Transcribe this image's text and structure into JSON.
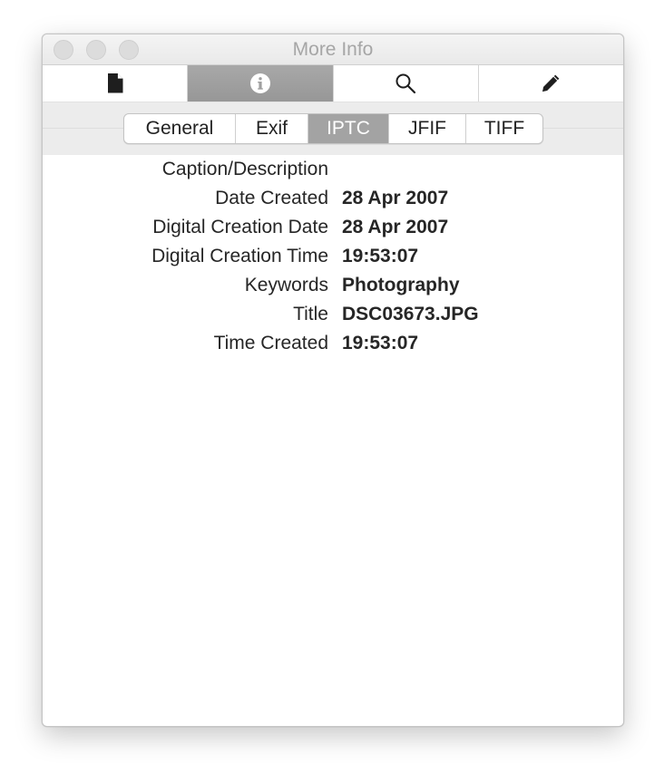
{
  "window": {
    "title": "More Info"
  },
  "toolbar": {
    "tabs": [
      {
        "icon": "document-icon",
        "active": false
      },
      {
        "icon": "info-icon",
        "active": true
      },
      {
        "icon": "search-icon",
        "active": false
      },
      {
        "icon": "pencil-icon",
        "active": false
      }
    ]
  },
  "segments": {
    "items": [
      "General",
      "Exif",
      "IPTC",
      "JFIF",
      "TIFF"
    ],
    "selected": "IPTC"
  },
  "metadata": {
    "rows": [
      {
        "label": "Caption/Description",
        "value": ""
      },
      {
        "label": "Date Created",
        "value": "28 Apr 2007"
      },
      {
        "label": "Digital Creation Date",
        "value": "28 Apr 2007"
      },
      {
        "label": "Digital Creation Time",
        "value": "19:53:07"
      },
      {
        "label": "Keywords",
        "value": "Photography"
      },
      {
        "label": "Title",
        "value": "DSC03673.JPG"
      },
      {
        "label": "Time Created",
        "value": "19:53:07"
      }
    ]
  },
  "colors": {
    "active_tab": "#9f9f9f",
    "active_segment": "#a3a3a3",
    "title_text": "#a6a6a6"
  }
}
